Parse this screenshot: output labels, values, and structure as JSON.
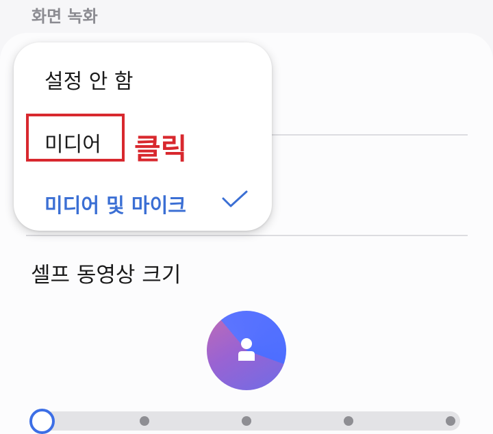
{
  "section": {
    "title": "화면 녹화"
  },
  "sound_menu": {
    "options": [
      {
        "label": "설정 안 함",
        "selected": false
      },
      {
        "label": "미디어",
        "selected": false
      },
      {
        "label": "미디어 및 마이크",
        "selected": true
      }
    ]
  },
  "selfie": {
    "label": "셀프 동영상 크기",
    "slider": {
      "steps": 5,
      "current_step": 1
    }
  },
  "annotation": {
    "text": "클릭"
  },
  "colors": {
    "accent": "#3b6fd4",
    "annotation_red": "#d8282e",
    "avatar_gradient_start": "#c06cb4",
    "avatar_gradient_end": "#4d6eff"
  },
  "icons": {
    "check": "check-icon",
    "person": "person-icon"
  }
}
